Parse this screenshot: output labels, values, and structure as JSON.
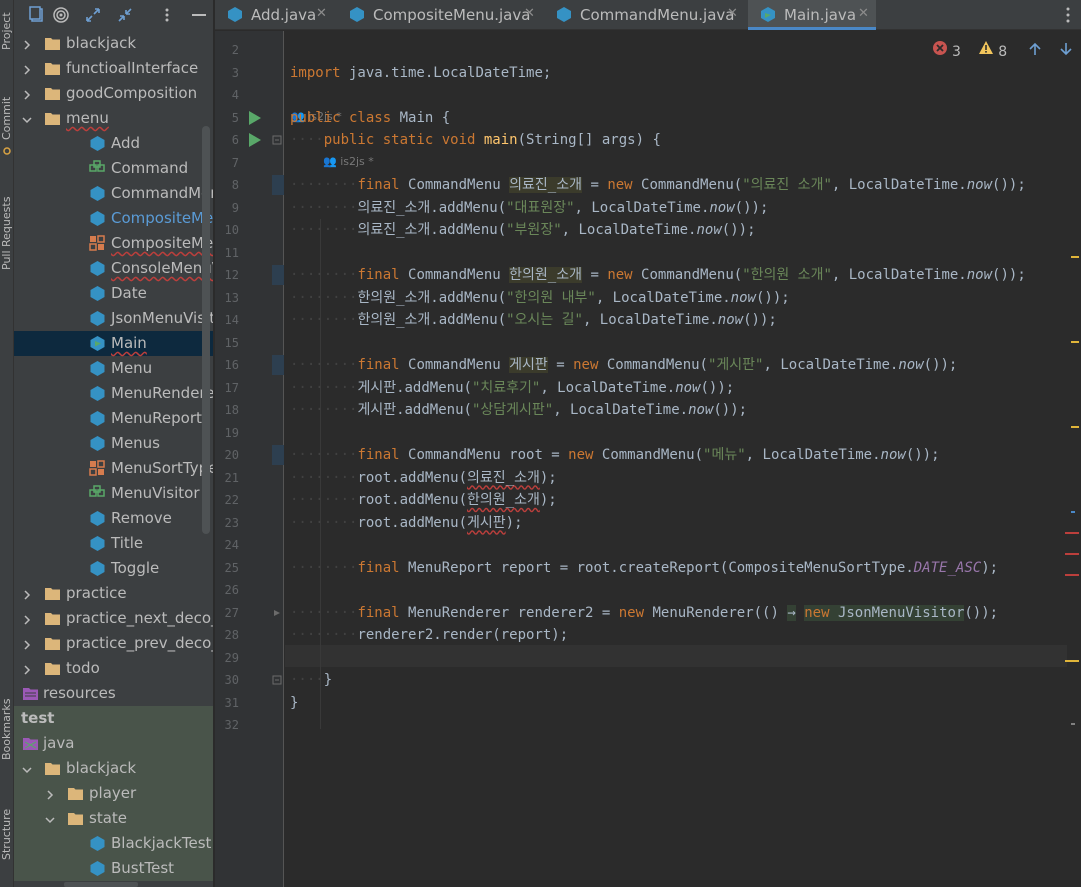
{
  "toolstrip": {
    "project_label": "Project",
    "commit_label": "Commit",
    "pull_requests_label": "Pull Requests",
    "bookmarks_label": "Bookmarks",
    "structure_label": "Structure"
  },
  "project_tree": [
    {
      "label": "blackjack",
      "type": "folder",
      "indent": 0,
      "arrow": "right"
    },
    {
      "label": "functioalInterface",
      "type": "folder",
      "indent": 0,
      "arrow": "right"
    },
    {
      "label": "goodComposition",
      "type": "folder",
      "indent": 0,
      "arrow": "right"
    },
    {
      "label": "menu",
      "type": "folder",
      "indent": 0,
      "arrow": "down",
      "squiggle": true
    },
    {
      "label": "Add",
      "type": "class",
      "indent": 1
    },
    {
      "label": "Command",
      "type": "interface",
      "indent": 1
    },
    {
      "label": "CommandMenu",
      "type": "class",
      "indent": 1
    },
    {
      "label": "CompositeMenu",
      "type": "class",
      "indent": 1,
      "blue": true
    },
    {
      "label": "CompositeMenuSortType",
      "type": "enum",
      "indent": 1
    },
    {
      "label": "ConsoleMenuVisitor",
      "type": "class",
      "indent": 1
    },
    {
      "label": "Date",
      "type": "class",
      "indent": 1
    },
    {
      "label": "JsonMenuVisitor",
      "type": "class",
      "indent": 1
    },
    {
      "label": "Main",
      "type": "main",
      "indent": 1,
      "selected": true
    },
    {
      "label": "Menu",
      "type": "class",
      "indent": 1
    },
    {
      "label": "MenuRenderer",
      "type": "class",
      "indent": 1
    },
    {
      "label": "MenuReport",
      "type": "class",
      "indent": 1
    },
    {
      "label": "Menus",
      "type": "class",
      "indent": 1
    },
    {
      "label": "MenuSortType",
      "type": "enum",
      "indent": 1
    },
    {
      "label": "MenuVisitor",
      "type": "interface",
      "indent": 1
    },
    {
      "label": "Remove",
      "type": "class",
      "indent": 1
    },
    {
      "label": "Title",
      "type": "class",
      "indent": 1
    },
    {
      "label": "Toggle",
      "type": "class",
      "indent": 1
    },
    {
      "label": "practice",
      "type": "folder",
      "indent": 0,
      "arrow": "right"
    },
    {
      "label": "practice_next_deco_fo",
      "type": "folder",
      "indent": 0,
      "arrow": "right"
    },
    {
      "label": "practice_prev_deco_fo",
      "type": "folder",
      "indent": 0,
      "arrow": "right"
    },
    {
      "label": "todo",
      "type": "folder",
      "indent": 0,
      "arrow": "right"
    },
    {
      "label": "resources",
      "type": "resources",
      "indent": -1
    },
    {
      "label": "test",
      "type": "bold",
      "indent": -2,
      "test": true
    },
    {
      "label": "java",
      "type": "java",
      "indent": -1,
      "test": true
    },
    {
      "label": "blackjack",
      "type": "folder",
      "indent": 0,
      "arrow": "down",
      "test": true
    },
    {
      "label": "player",
      "type": "folder",
      "indent": 1,
      "arrow": "right",
      "test": true
    },
    {
      "label": "state",
      "type": "folder",
      "indent": 1,
      "arrow": "down",
      "test": true
    },
    {
      "label": "BlackjackTest",
      "type": "class",
      "indent": 2,
      "test": true
    },
    {
      "label": "BustTest",
      "type": "class",
      "indent": 2,
      "test": true
    }
  ],
  "tabs": [
    {
      "label": "Add.java",
      "active": false
    },
    {
      "label": "CompositeMenu.java",
      "active": false
    },
    {
      "label": "CommandMenu.java",
      "active": false
    },
    {
      "label": "Main.java",
      "active": true
    }
  ],
  "inspections": {
    "errors": "3",
    "warnings": "8"
  },
  "author_hint": "is2js *",
  "code_lines": [
    {
      "n": "2",
      "html": ""
    },
    {
      "n": "3",
      "html": "<span class='kw'>import</span> java.time.LocalDateTime;"
    },
    {
      "n": "4",
      "html": ""
    },
    {
      "n": "5",
      "html": "<span class='kw'>public class</span> Main {"
    },
    {
      "n": "6",
      "html": "<span class='dots'>····</span><span class='kw'>public static void</span> <span class='fn'>main</span>(String[] args) {"
    },
    {
      "n": "7",
      "html": ""
    },
    {
      "n": "8",
      "html": "<span class='dots'>········</span><span class='kw'>final</span> CommandMenu <span class='hl'>의료진_소개</span> = <span class='kw'>new</span> CommandMenu(<span class='st'>\"의료진 소개\"</span>, LocalDateTime.<span class='it'>now</span>());"
    },
    {
      "n": "9",
      "html": "<span class='dots'>········</span>의료진_소개.addMenu(<span class='st'>\"대표원장\"</span>, LocalDateTime.<span class='it'>now</span>());"
    },
    {
      "n": "10",
      "html": "<span class='dots'>········</span>의료진_소개.addMenu(<span class='st'>\"부원장\"</span>, LocalDateTime.<span class='it'>now</span>());"
    },
    {
      "n": "11",
      "html": ""
    },
    {
      "n": "12",
      "html": "<span class='dots'>········</span><span class='kw'>final</span> CommandMenu <span class='hl'>한의원_소개</span> = <span class='kw'>new</span> CommandMenu(<span class='st'>\"한의원 소개\"</span>, LocalDateTime.<span class='it'>now</span>());"
    },
    {
      "n": "13",
      "html": "<span class='dots'>········</span>한의원_소개.addMenu(<span class='st'>\"한의원 내부\"</span>, LocalDateTime.<span class='it'>now</span>());"
    },
    {
      "n": "14",
      "html": "<span class='dots'>········</span>한의원_소개.addMenu(<span class='st'>\"오시는 길\"</span>, LocalDateTime.<span class='it'>now</span>());"
    },
    {
      "n": "15",
      "html": ""
    },
    {
      "n": "16",
      "html": "<span class='dots'>········</span><span class='kw'>final</span> CommandMenu <span class='hl'>게시판</span> = <span class='kw'>new</span> CommandMenu(<span class='st'>\"게시판\"</span>, LocalDateTime.<span class='it'>now</span>());"
    },
    {
      "n": "17",
      "html": "<span class='dots'>········</span>게시판.addMenu(<span class='st'>\"치료후기\"</span>, LocalDateTime.<span class='it'>now</span>());"
    },
    {
      "n": "18",
      "html": "<span class='dots'>········</span>게시판.addMenu(<span class='st'>\"상담게시판\"</span>, LocalDateTime.<span class='it'>now</span>());"
    },
    {
      "n": "19",
      "html": ""
    },
    {
      "n": "20",
      "html": "<span class='dots'>········</span><span class='kw'>final</span> CommandMenu root = <span class='kw'>new</span> CommandMenu(<span class='st'>\"메뉴\"</span>, LocalDateTime.<span class='it'>now</span>());"
    },
    {
      "n": "21",
      "html": "<span class='dots'>········</span>root.addMenu(<span class='sq'>의료진_소개</span>);"
    },
    {
      "n": "22",
      "html": "<span class='dots'>········</span>root.addMenu(<span class='sq'>한의원_소개</span>);"
    },
    {
      "n": "23",
      "html": "<span class='dots'>········</span>root.addMenu(<span class='sq'>게시판</span>);"
    },
    {
      "n": "24",
      "html": ""
    },
    {
      "n": "25",
      "html": "<span class='dots'>········</span><span class='kw'>final</span> MenuReport report = root.createReport(CompositeMenuSortType.<span class='cn'>DATE_ASC</span>);"
    },
    {
      "n": "26",
      "html": ""
    },
    {
      "n": "27",
      "html": "<span class='dots'>········</span><span class='kw'>final</span> MenuRenderer renderer2 = <span class='kw'>new</span> MenuRenderer(() <span class='hl2'>→</span> <span class='hl2'><span class='kw'>new</span> JsonMenuVisitor</span>());"
    },
    {
      "n": "28",
      "html": "<span class='dots'>········</span>renderer2.render(report);"
    },
    {
      "n": "29",
      "html": ""
    },
    {
      "n": "30",
      "html": "<span class='dots'>····</span>}"
    },
    {
      "n": "31",
      "html": "}"
    },
    {
      "n": "32",
      "html": ""
    }
  ],
  "colors": {
    "keyword": "#cc7832",
    "string": "#6a8759",
    "method": "#ffc66d",
    "constant": "#9876aa",
    "error": "#bc3f3c",
    "warning": "#e0b53a",
    "selection": "#0d293e"
  }
}
